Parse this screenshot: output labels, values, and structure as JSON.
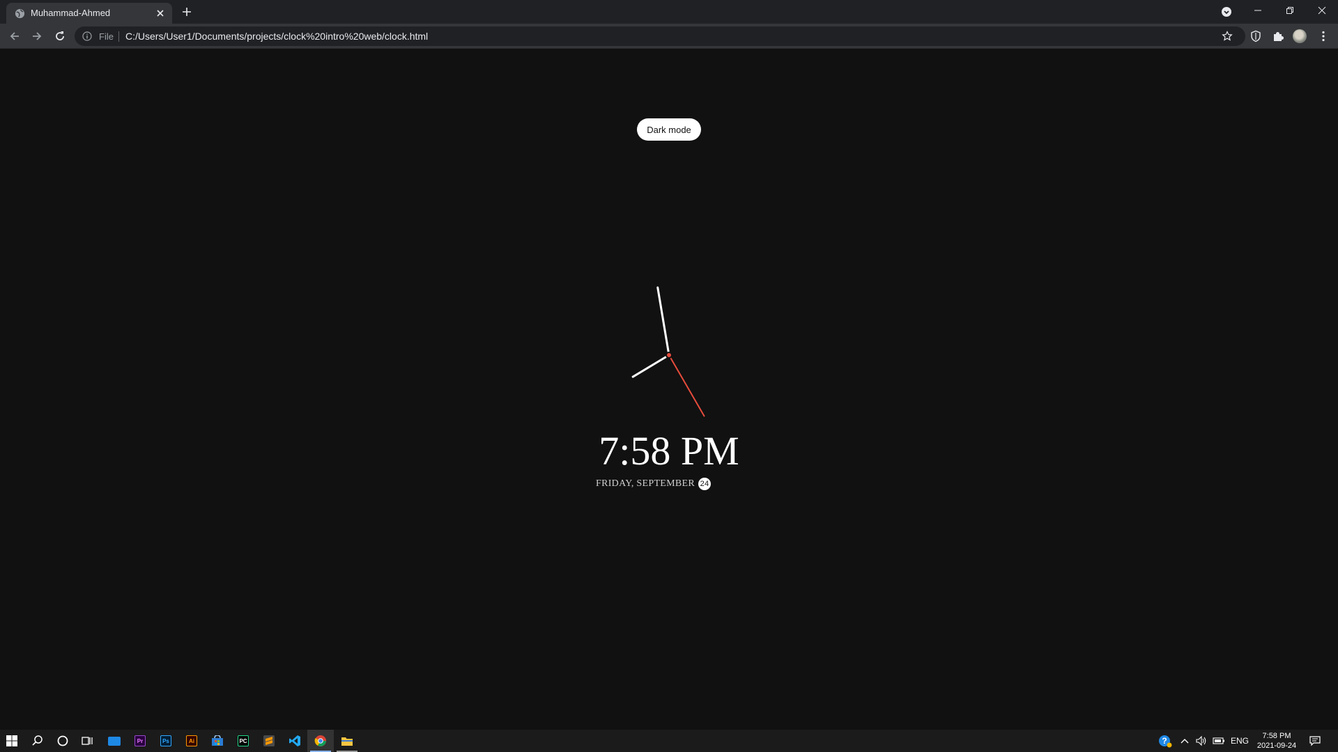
{
  "browser": {
    "tab": {
      "title": "Muhammad-Ahmed"
    },
    "address": {
      "scheme_label": "File",
      "url": "C:/Users/User1/Documents/projects/clock%20intro%20web/clock.html"
    }
  },
  "page": {
    "toggle_label": "Dark mode",
    "time": "7:58 PM",
    "date_text": "FRIDAY, SEPTEMBER",
    "date_day": "24",
    "analog": {
      "hour": 7,
      "minute": 58,
      "second": 25
    }
  },
  "taskbar": {
    "apps": [
      "start",
      "search",
      "cortana",
      "task-view",
      "desktop",
      "premiere-pro",
      "photoshop",
      "illustrator",
      "store",
      "pycharm",
      "sublime-text",
      "vscode",
      "chrome",
      "file-explorer"
    ],
    "tray": {
      "language": "ENG",
      "time": "7:58 PM",
      "date": "2021-09-24"
    }
  },
  "colors": {
    "background": "#111111",
    "second_hand": "#e74c3c",
    "hands": "#ffffff"
  }
}
